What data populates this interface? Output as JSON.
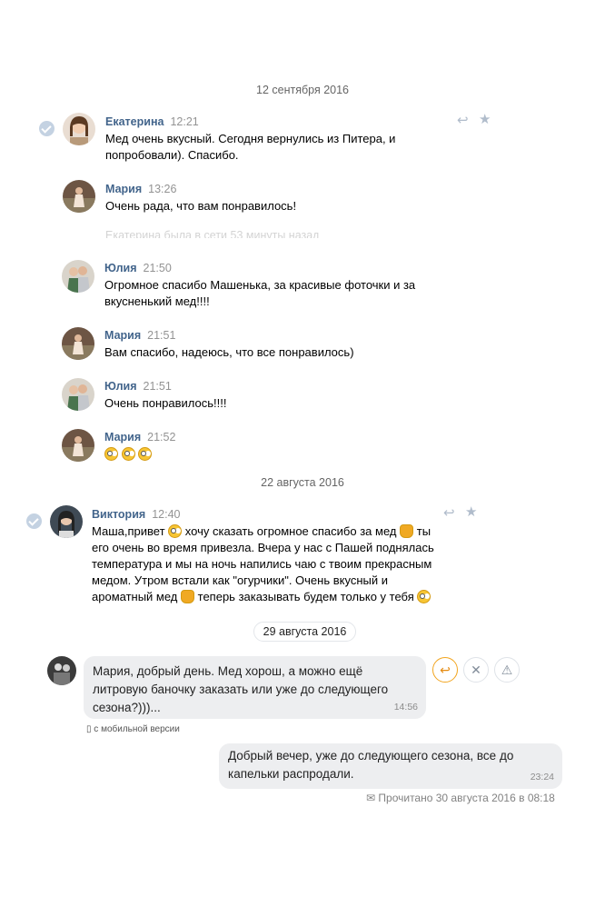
{
  "dates": {
    "d1": "12 сентября 2016",
    "d2": "22 августа 2016",
    "d3": "29 августа 2016"
  },
  "messages": [
    {
      "name": "Екатерина",
      "time": "12:21",
      "text": "Мед очень вкусный. Сегодня вернулись из Питера, и попробовали). Спасибо."
    },
    {
      "name": "Мария",
      "time": "13:26",
      "text": "Очень рада, что вам понравилось!"
    },
    {
      "name": "Юлия",
      "time": "21:50",
      "text": "Огромное спасибо Машенька, за красивые фоточки и за вкусненький мед!!!!"
    },
    {
      "name": "Мария",
      "time": "21:51",
      "text": "Вам спасибо, надеюсь, что все понравилось)"
    },
    {
      "name": "Юлия",
      "time": "21:51",
      "text": "Очень понравилось!!!!"
    },
    {
      "name": "Мария",
      "time": "21:52",
      "text": ""
    },
    {
      "name": "Виктория",
      "time": "12:40",
      "text_parts": [
        "Маша,привет",
        "хочу сказать огромное спасибо за мед",
        "ты его очень во время привезла. Вчера у нас с Пашей поднялась температура и мы на ночь напились чаю с твоим прекрасным медом. Утром встали как \"огурчики\". Очень вкусный и ароматный мед",
        "теперь заказывать будем только у тебя"
      ]
    }
  ],
  "faded_status": "Екатерина была в сети 53 минуты назад",
  "chat": {
    "incoming_text": "Мария, добрый день. Мед хорош, а можно ещё литровую баночку заказать или уже до следующего сезона?)))...",
    "incoming_time": "14:56",
    "mobile_note": "с мобильной версии",
    "outgoing_text": "Добрый вечер, уже до следующего сезона, все до капельки распродали.",
    "outgoing_time": "23:24",
    "read_status": "Прочитано 30 августа 2016 в 08:18"
  },
  "icons": {
    "reply": "reply-icon",
    "star": "star-icon",
    "close": "close-icon",
    "warning": "warning-icon",
    "check": "check-icon",
    "phone": "phone-icon",
    "envelope": "envelope-icon"
  },
  "colors": {
    "name": "#42648b",
    "accent": "#f2a51f",
    "bubble": "#edeef0"
  }
}
